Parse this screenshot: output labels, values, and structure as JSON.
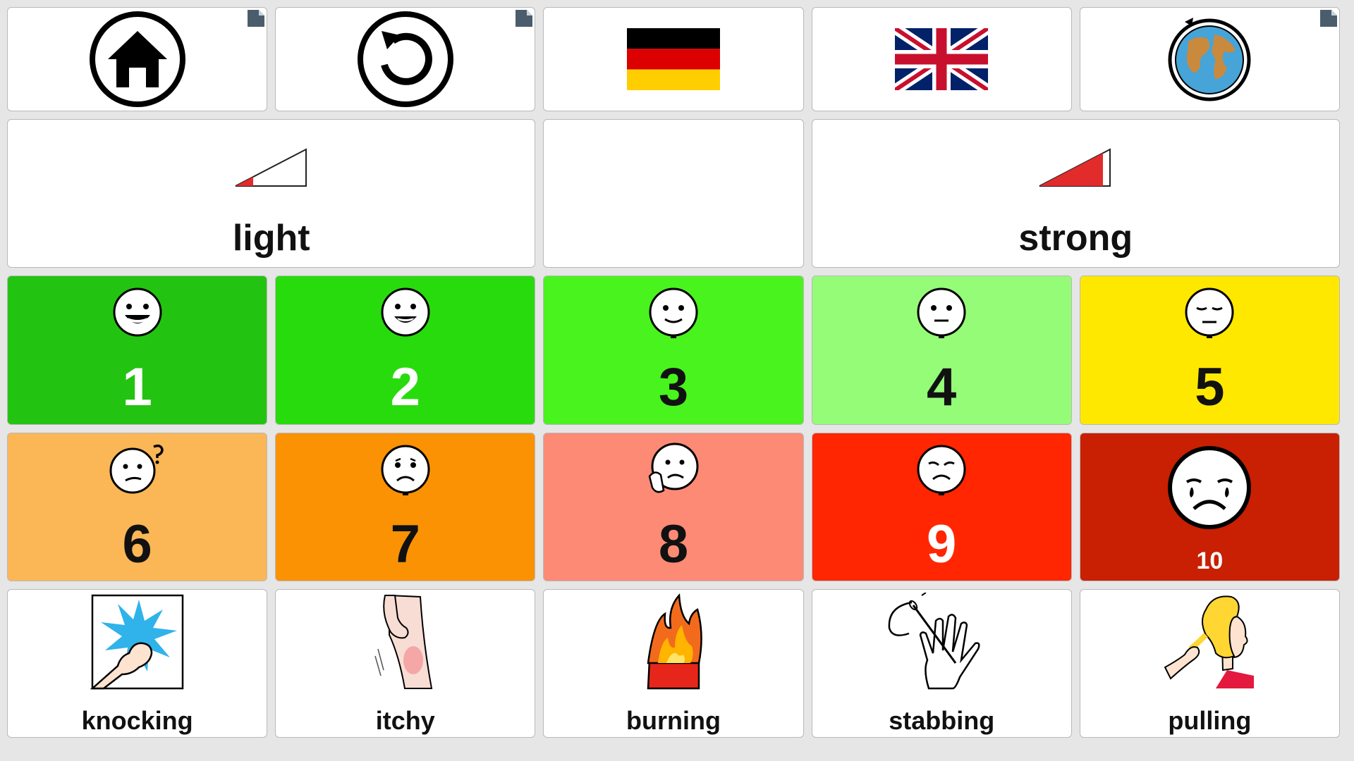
{
  "toolbar": {
    "home_icon": "home-icon",
    "back_icon": "undo-icon",
    "german_flag": "germany-flag-icon",
    "english_flag": "uk-flag-icon",
    "globe_icon": "globe-refresh-icon"
  },
  "intensity": {
    "light_label": "light",
    "strong_label": "strong",
    "light_level": 0.25,
    "strong_level": 0.9
  },
  "scale": [
    {
      "value": "1",
      "color": "#22c411",
      "text_color": "#ffffff",
      "face": "very-happy-face-icon"
    },
    {
      "value": "2",
      "color": "#28db0c",
      "text_color": "#ffffff",
      "face": "happy-face-icon"
    },
    {
      "value": "3",
      "color": "#48f31e",
      "text_color": "#111111",
      "face": "smile-face-icon"
    },
    {
      "value": "4",
      "color": "#95fc78",
      "text_color": "#111111",
      "face": "neutral-face-icon"
    },
    {
      "value": "5",
      "color": "#ffe800",
      "text_color": "#111111",
      "face": "tired-face-icon"
    },
    {
      "value": "6",
      "color": "#fbb656",
      "text_color": "#111111",
      "face": "confused-face-icon"
    },
    {
      "value": "7",
      "color": "#fa9203",
      "text_color": "#111111",
      "face": "sad-face-icon"
    },
    {
      "value": "8",
      "color": "#fd8a75",
      "text_color": "#111111",
      "face": "worried-face-icon"
    },
    {
      "value": "9",
      "color": "#ff2601",
      "text_color": "#ffffff",
      "face": "upset-face-icon"
    },
    {
      "value": "10",
      "color": "#c91f02",
      "text_color": "#ffffff",
      "face": "crying-face-icon"
    }
  ],
  "pain_types": [
    {
      "label": "knocking",
      "icon": "knocking-fist-icon"
    },
    {
      "label": "itchy",
      "icon": "itchy-leg-icon"
    },
    {
      "label": "burning",
      "icon": "fire-icon"
    },
    {
      "label": "stabbing",
      "icon": "needle-hand-icon"
    },
    {
      "label": "pulling",
      "icon": "hair-pulling-icon"
    }
  ]
}
